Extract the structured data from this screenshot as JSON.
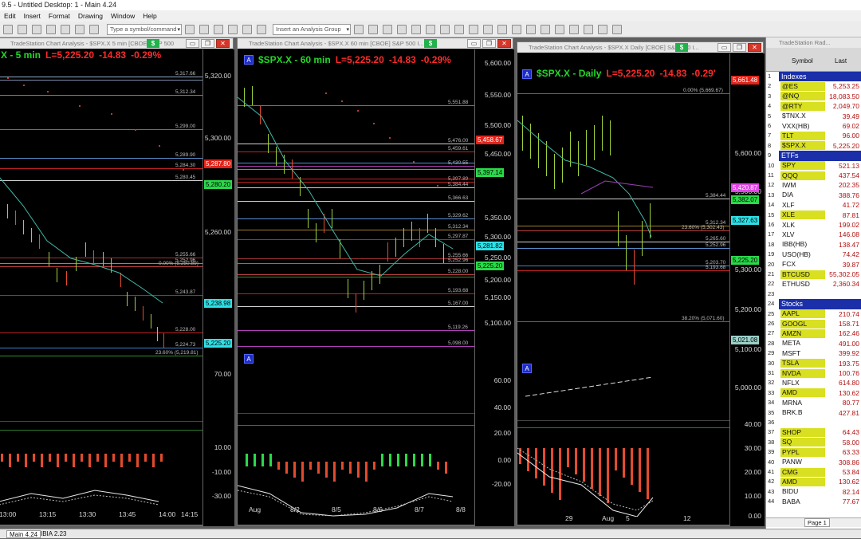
{
  "app_title": "9.5 - Untitled Desktop: 1 - Main 4.24",
  "menu": [
    "Edit",
    "Insert",
    "Format",
    "Drawing",
    "Window",
    "Help"
  ],
  "toolbar": {
    "symbol_placeholder": "Type a symbol/command",
    "group_placeholder": "Insert an Analysis Group"
  },
  "chart_5min": {
    "window_title": "TradeStation Chart Analysis - $SPX.X 5 min [CBOE] S&P 500",
    "symbol": "X - 5 min",
    "price": "L=5,225.20",
    "change": "-14.83",
    "pct": "-0.29%",
    "axis": [
      "5,320.00",
      "5,300.00",
      "5,260.00"
    ],
    "levels": [
      "5,317.66",
      "5,312.34",
      "5,299.00",
      "5,289.90",
      "5,284.30",
      "5,280.45",
      "5,255.66",
      "5,252.96",
      "5,243.87",
      "5,228.00",
      "5,224.73"
    ],
    "fib_lines": [
      "0.00% (5,250.89)",
      "23.60% (5,219.81)"
    ],
    "tags": [
      "5,287.80",
      "5,280.20",
      "5,238.98",
      "5,225.20"
    ],
    "osc_axis": [
      "70.00",
      "10.00",
      "-10.00",
      "-30.00"
    ],
    "times": [
      "13:00",
      "13:15",
      "13:30",
      "13:45",
      "14:00",
      "14:15"
    ]
  },
  "chart_60min": {
    "window_title": "TradeStation Chart Analysis - $SPX.X 60 min [CBOE] S&P 500 I...",
    "symbol": "$SPX.X - 60 min",
    "price": "L=5,225.20",
    "change": "-14.83",
    "pct": "-0.29%",
    "axis": [
      "5,600.00",
      "5,550.00",
      "5,500.00",
      "5,450.00",
      "5,350.00",
      "5,300.00",
      "5,250.00",
      "5,200.00",
      "5,150.00",
      "5,100.00"
    ],
    "levels": [
      "5,551.88",
      "5,476.00",
      "5,459.61",
      "5,430.55",
      "5,397.89",
      "5,384.44",
      "5,366.63",
      "5,329.62",
      "5,312.34",
      "5,297.87",
      "5,255.66",
      "5,252.96",
      "5,228.00",
      "5,193.68",
      "5,167.00",
      "5,119.26",
      "5,098.00"
    ],
    "tags": [
      "5,458.67",
      "5,397.14",
      "5,281.82",
      "5,225.20"
    ],
    "osc_axis": [
      "60.00",
      "40.00",
      "20.00",
      "0.00",
      "-20.00"
    ],
    "dates": [
      "Aug",
      "8/2",
      "8/5",
      "8/6",
      "8/7",
      "8/8"
    ]
  },
  "chart_daily": {
    "window_title": "TradeStation Chart Analysis - $SPX.X Daily [CBOE] S&P 500 I...",
    "symbol": "$SPX.X - Daily",
    "price": "L=5,225.20",
    "change": "-14.83",
    "pct": "-0.29'",
    "axis": [
      "5,600.00",
      "5,500.00",
      "5,300.00",
      "5,200.00",
      "5,100.00",
      "5,000.00"
    ],
    "levels": [
      "5,384.44",
      "5,312.34",
      "5,265.60",
      "5,252.96",
      "5,203.70",
      "5,193.68"
    ],
    "fib_lines": [
      "0.00% (5,669.67)",
      "23.60% (5,302.43)",
      "38.20% (5,071.60)"
    ],
    "tags": [
      "5,661.48",
      "5,420.87",
      "5,382.07",
      "5,327.63",
      "5,225.20",
      "5,021.08"
    ],
    "osc_axis": [
      "40.00",
      "30.00",
      "20.00",
      "10.00",
      "0.00",
      "-10.00"
    ],
    "dates": [
      "29",
      "Aug",
      "5",
      "12"
    ]
  },
  "radar": {
    "title": "TradeStation Rad...",
    "col_symbol": "Symbol",
    "col_last": "Last",
    "rows": [
      {
        "n": "1",
        "section": "Indexes"
      },
      {
        "n": "2",
        "sym": "@ES",
        "last": "5,253.25",
        "hl": true
      },
      {
        "n": "3",
        "sym": "@NQ",
        "last": "18,083.50",
        "hl": true
      },
      {
        "n": "4",
        "sym": "@RTY",
        "last": "2,049.70",
        "hl": true
      },
      {
        "n": "5",
        "sym": "$TNX.X",
        "last": "39.49"
      },
      {
        "n": "6",
        "sym": "VXX(HB)",
        "last": "69.02"
      },
      {
        "n": "7",
        "sym": "TLT",
        "last": "96.00",
        "hl": true
      },
      {
        "n": "8",
        "sym": "$SPX.X",
        "last": "5,225.20",
        "hl": true
      },
      {
        "n": "9",
        "section": "ETFs"
      },
      {
        "n": "10",
        "sym": "SPY",
        "last": "521.13",
        "hl": true
      },
      {
        "n": "11",
        "sym": "QQQ",
        "last": "437.54",
        "hl": true
      },
      {
        "n": "12",
        "sym": "IWM",
        "last": "202.35"
      },
      {
        "n": "13",
        "sym": "DIA",
        "last": "388.76"
      },
      {
        "n": "14",
        "sym": "XLF",
        "last": "41.72"
      },
      {
        "n": "15",
        "sym": "XLE",
        "last": "87.81",
        "hl": true
      },
      {
        "n": "16",
        "sym": "XLK",
        "last": "199.02"
      },
      {
        "n": "17",
        "sym": "XLV",
        "last": "146.08"
      },
      {
        "n": "18",
        "sym": "IBB(HB)",
        "last": "138.47"
      },
      {
        "n": "19",
        "sym": "USO(HB)",
        "last": "74.42"
      },
      {
        "n": "20",
        "sym": "FCX",
        "last": "39.87"
      },
      {
        "n": "21",
        "sym": "BTCUSD",
        "last": "55,302.05",
        "hl": true
      },
      {
        "n": "22",
        "sym": "ETHUSD",
        "last": "2,360.34"
      },
      {
        "n": "23",
        "sym": "",
        "last": ""
      },
      {
        "n": "24",
        "section": "Stocks"
      },
      {
        "n": "25",
        "sym": "AAPL",
        "last": "210.74",
        "hl": true
      },
      {
        "n": "26",
        "sym": "GOOGL",
        "last": "158.71",
        "hl": true
      },
      {
        "n": "27",
        "sym": "AMZN",
        "last": "162.46",
        "hl": true
      },
      {
        "n": "28",
        "sym": "META",
        "last": "491.00"
      },
      {
        "n": "29",
        "sym": "MSFT",
        "last": "399.92"
      },
      {
        "n": "30",
        "sym": "TSLA",
        "last": "193.75",
        "hl": true
      },
      {
        "n": "31",
        "sym": "NVDA",
        "last": "100.76",
        "hl": true
      },
      {
        "n": "32",
        "sym": "NFLX",
        "last": "614.80"
      },
      {
        "n": "33",
        "sym": "AMD",
        "last": "130.62",
        "hl": true
      },
      {
        "n": "34",
        "sym": "MRNA",
        "last": "80.77"
      },
      {
        "n": "35",
        "sym": "BRK.B",
        "last": "427.81"
      },
      {
        "n": "36",
        "sym": "",
        "last": ""
      },
      {
        "n": "37",
        "sym": "SHOP",
        "last": "64.43",
        "hl": true
      },
      {
        "n": "38",
        "sym": "SQ",
        "last": "58.00",
        "hl": true
      },
      {
        "n": "39",
        "sym": "PYPL",
        "last": "63.33",
        "hl": true
      },
      {
        "n": "40",
        "sym": "PANW",
        "last": "308.86"
      },
      {
        "n": "41",
        "sym": "CMG",
        "last": "53.84",
        "hl": true
      },
      {
        "n": "42",
        "sym": "AMD",
        "last": "130.62",
        "hl": true
      },
      {
        "n": "43",
        "sym": "BIDU",
        "last": "82.14"
      },
      {
        "n": "44",
        "sym": "BABA",
        "last": "77.67"
      }
    ],
    "page_tab": "Page 1"
  },
  "workspace_tabs": [
    "Main 4.24",
    "IBIA 2.23"
  ],
  "colors": {
    "up": "#9fd03a",
    "down": "#e34b2e",
    "tag_green": "#2bd94a",
    "tag_cyan": "#2ee0e6",
    "tag_red": "#e0241b",
    "section": "#1a2fa8",
    "highlight": "#d9e021"
  }
}
